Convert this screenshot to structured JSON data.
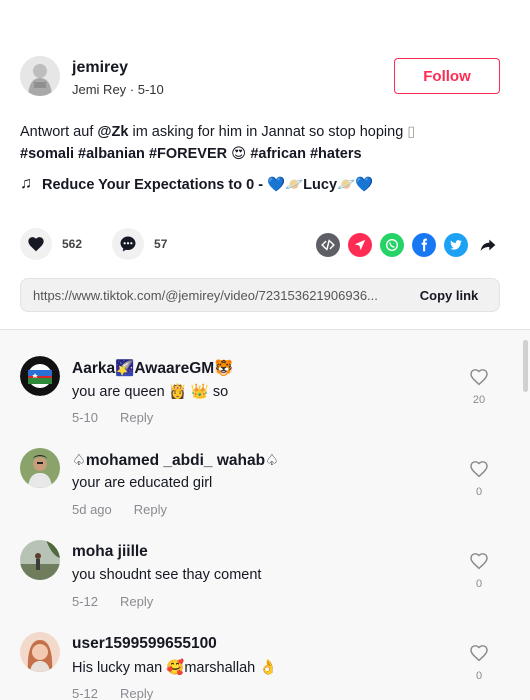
{
  "author": {
    "username": "jemirey",
    "nickname_date": "Jemi Rey · 5-10",
    "follow_label": "Follow"
  },
  "description": {
    "prefix": "Antwort auf ",
    "mention": "@Zk",
    "text": " im asking for him in Jannat so stop hoping ",
    "tags": [
      "#somali",
      "#albanian",
      "#FOREVER"
    ],
    "emoji": "😍",
    "tags2": [
      "#african",
      "#haters"
    ]
  },
  "music": {
    "title": "Reduce Your Expectations to 0 - 💙🪐Lucy🪐💙"
  },
  "stats": {
    "likes": "562",
    "comments": "57"
  },
  "share_icons": [
    "embed-icon",
    "send-icon",
    "whatsapp-icon",
    "facebook-icon",
    "twitter-icon",
    "share-arrow-icon"
  ],
  "colors": {
    "accent": "#fe2c55",
    "embed": "#5e5f66",
    "send": "#fe2c55",
    "whatsapp": "#25d366",
    "facebook": "#1877f2",
    "twitter": "#1da1f2"
  },
  "copy": {
    "url": "https://www.tiktok.com/@jemirey/video/723153621906936...",
    "button": "Copy link"
  },
  "comments": [
    {
      "name": "Aarka🌠AwaareGM🐯",
      "text": "you are queen 👸 👑 so",
      "date": "5-10",
      "reply": "Reply",
      "likes": "20"
    },
    {
      "name": "♤mohamed _abdi_ wahab♤",
      "text": "your are educated girl",
      "date": "5d ago",
      "reply": "Reply",
      "likes": "0"
    },
    {
      "name": "moha jiille",
      "text": "you shoudnt see thay coment",
      "date": "5-12",
      "reply": "Reply",
      "likes": "0"
    },
    {
      "name": "user1599599655100",
      "text": "His lucky man 🥰marshallah 👌",
      "date": "5-12",
      "reply": "Reply",
      "likes": "0"
    }
  ]
}
